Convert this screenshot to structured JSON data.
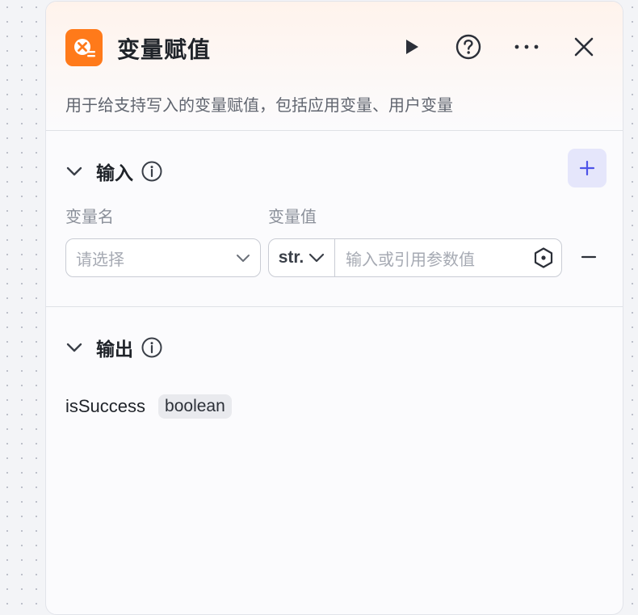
{
  "header": {
    "title": "变量赋值",
    "description": "用于给支持写入的变量赋值，包括应用变量、用户变量",
    "icons": {
      "node": "variable-assign-icon",
      "run": "play-icon",
      "help": "help-circle-icon",
      "more": "more-horizontal-icon",
      "close": "close-icon"
    },
    "accent_color": "#ff7a1a"
  },
  "input_section": {
    "title": "输入",
    "columns": {
      "name_label": "变量名",
      "value_label": "变量值"
    },
    "row": {
      "name_placeholder": "请选择",
      "type_label": "str.",
      "value_placeholder": "输入或引用参数值"
    },
    "add_icon": "plus-icon",
    "remove_icon": "minus-icon",
    "add_button_bg": "#e5e6fb",
    "add_icon_color": "#4d53e8"
  },
  "output_section": {
    "title": "输出",
    "items": [
      {
        "name": "isSuccess",
        "type": "boolean"
      }
    ]
  }
}
